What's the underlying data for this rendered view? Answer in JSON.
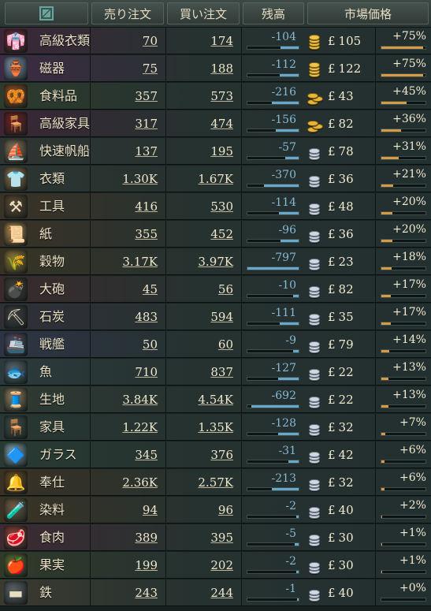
{
  "header": {
    "sell_orders": "売り注文",
    "buy_orders": "買い注文",
    "balance": "残高",
    "market_price": "市場価格"
  },
  "currency_symbol": "£",
  "goods": [
    {
      "name": "高級衣類",
      "sell": "70",
      "buy": "174",
      "balance": "-104",
      "balance_value": -104,
      "tier": "gold-stack",
      "price": "105",
      "change": "+75%",
      "change_value": 75,
      "icon": "luxury-clothes-icon",
      "color": "#6a2a35",
      "glyph": "👘"
    },
    {
      "name": "磁器",
      "sell": "75",
      "buy": "188",
      "balance": "-112",
      "balance_value": -112,
      "tier": "gold-stack",
      "price": "122",
      "change": "+75%",
      "change_value": 75,
      "icon": "porcelain-icon",
      "color": "#7b8eaa",
      "glyph": "🏺"
    },
    {
      "name": "食料品",
      "sell": "357",
      "buy": "573",
      "balance": "-216",
      "balance_value": -216,
      "tier": "gold-coins",
      "price": "43",
      "change": "+45%",
      "change_value": 45,
      "icon": "groceries-icon",
      "color": "#8a4b24",
      "glyph": "🥨"
    },
    {
      "name": "高級家具",
      "sell": "317",
      "buy": "474",
      "balance": "-156",
      "balance_value": -156,
      "tier": "gold-coins",
      "price": "82",
      "change": "+36%",
      "change_value": 36,
      "icon": "luxury-furniture-icon",
      "color": "#6e1f22",
      "glyph": "🪑"
    },
    {
      "name": "快速帆船",
      "sell": "137",
      "buy": "195",
      "balance": "-57",
      "balance_value": -57,
      "tier": "silver",
      "price": "78",
      "change": "+31%",
      "change_value": 31,
      "icon": "clipper-ship-icon",
      "color": "#7f6f55",
      "glyph": "⛵"
    },
    {
      "name": "衣類",
      "sell": "1.30K",
      "buy": "1.67K",
      "balance": "-370",
      "balance_value": -370,
      "tier": "silver",
      "price": "36",
      "change": "+21%",
      "change_value": 21,
      "icon": "clothes-icon",
      "color": "#8b6e4a",
      "glyph": "👕"
    },
    {
      "name": "工具",
      "sell": "416",
      "buy": "530",
      "balance": "-114",
      "balance_value": -114,
      "tier": "silver",
      "price": "48",
      "change": "+20%",
      "change_value": 20,
      "icon": "tools-icon",
      "color": "#5a4630",
      "glyph": "⚒"
    },
    {
      "name": "紙",
      "sell": "355",
      "buy": "452",
      "balance": "-96",
      "balance_value": -96,
      "tier": "silver",
      "price": "36",
      "change": "+20%",
      "change_value": 20,
      "icon": "paper-icon",
      "color": "#a8864f",
      "glyph": "📜"
    },
    {
      "name": "穀物",
      "sell": "3.17K",
      "buy": "3.97K",
      "balance": "-797",
      "balance_value": -797,
      "tier": "silver",
      "price": "23",
      "change": "+18%",
      "change_value": 18,
      "icon": "grain-icon",
      "color": "#8a7238",
      "glyph": "🌾"
    },
    {
      "name": "大砲",
      "sell": "45",
      "buy": "56",
      "balance": "-10",
      "balance_value": -10,
      "tier": "silver",
      "price": "82",
      "change": "+17%",
      "change_value": 17,
      "icon": "artillery-icon",
      "color": "#3d3a34",
      "glyph": "💣"
    },
    {
      "name": "石炭",
      "sell": "483",
      "buy": "594",
      "balance": "-111",
      "balance_value": -111,
      "tier": "silver",
      "price": "35",
      "change": "+17%",
      "change_value": 17,
      "icon": "coal-icon",
      "color": "#3a3b3d",
      "glyph": "⛏"
    },
    {
      "name": "戦艦",
      "sell": "50",
      "buy": "60",
      "balance": "-9",
      "balance_value": -9,
      "tier": "silver",
      "price": "79",
      "change": "+14%",
      "change_value": 14,
      "icon": "warship-icon",
      "color": "#4b4a63",
      "glyph": "🚢"
    },
    {
      "name": "魚",
      "sell": "710",
      "buy": "837",
      "balance": "-127",
      "balance_value": -127,
      "tier": "silver",
      "price": "22",
      "change": "+13%",
      "change_value": 13,
      "icon": "fish-icon",
      "color": "#55636d",
      "glyph": "🐟"
    },
    {
      "name": "生地",
      "sell": "3.84K",
      "buy": "4.54K",
      "balance": "-692",
      "balance_value": -692,
      "tier": "silver",
      "price": "22",
      "change": "+13%",
      "change_value": 13,
      "icon": "fabric-icon",
      "color": "#8a7a5c",
      "glyph": "🧵"
    },
    {
      "name": "家具",
      "sell": "1.22K",
      "buy": "1.35K",
      "balance": "-128",
      "balance_value": -128,
      "tier": "silver",
      "price": "32",
      "change": "+7%",
      "change_value": 7,
      "icon": "furniture-icon",
      "color": "#3d4a44",
      "glyph": "🪑"
    },
    {
      "name": "ガラス",
      "sell": "345",
      "buy": "376",
      "balance": "-31",
      "balance_value": -31,
      "tier": "silver",
      "price": "42",
      "change": "+6%",
      "change_value": 6,
      "icon": "glass-icon",
      "color": "#7d9aa3",
      "glyph": "🔷"
    },
    {
      "name": "奉仕",
      "sell": "2.36K",
      "buy": "2.57K",
      "balance": "-213",
      "balance_value": -213,
      "tier": "silver",
      "price": "32",
      "change": "+6%",
      "change_value": 6,
      "icon": "services-icon",
      "color": "#6b4a22",
      "glyph": "🔔"
    },
    {
      "name": "染料",
      "sell": "94",
      "buy": "96",
      "balance": "-2",
      "balance_value": -2,
      "tier": "silver",
      "price": "40",
      "change": "+2%",
      "change_value": 2,
      "icon": "dye-icon",
      "color": "#6f5a44",
      "glyph": "🧪"
    },
    {
      "name": "食肉",
      "sell": "389",
      "buy": "395",
      "balance": "-5",
      "balance_value": -5,
      "tier": "silver",
      "price": "30",
      "change": "+1%",
      "change_value": 1,
      "icon": "meat-icon",
      "color": "#8a3f36",
      "glyph": "🥩"
    },
    {
      "name": "果実",
      "sell": "199",
      "buy": "202",
      "balance": "-2",
      "balance_value": -2,
      "tier": "silver",
      "price": "30",
      "change": "+1%",
      "change_value": 1,
      "icon": "fruit-icon",
      "color": "#5c6b34",
      "glyph": "🍎"
    },
    {
      "name": "鉄",
      "sell": "243",
      "buy": "244",
      "balance": "-1",
      "balance_value": -1,
      "tier": "silver",
      "price": "40",
      "change": "+0%",
      "change_value": 0,
      "icon": "iron-icon",
      "color": "#5a5f63",
      "glyph": "▬"
    }
  ],
  "row_tints": [
    "#3c2739",
    "#3e2a44",
    "#2d3b2d",
    "#3b2636",
    "#2f3533",
    "#2c3531",
    "#3a3226",
    "#3a3226",
    "#373324",
    "#3a2a2c",
    "#302f38",
    "#2d3445",
    "#2b3a3c",
    "#2f3a33",
    "#283733",
    "#283a32",
    "#3a3124",
    "#3a3324",
    "#3d2a33",
    "#2f3a2a",
    "#3a3a30"
  ]
}
